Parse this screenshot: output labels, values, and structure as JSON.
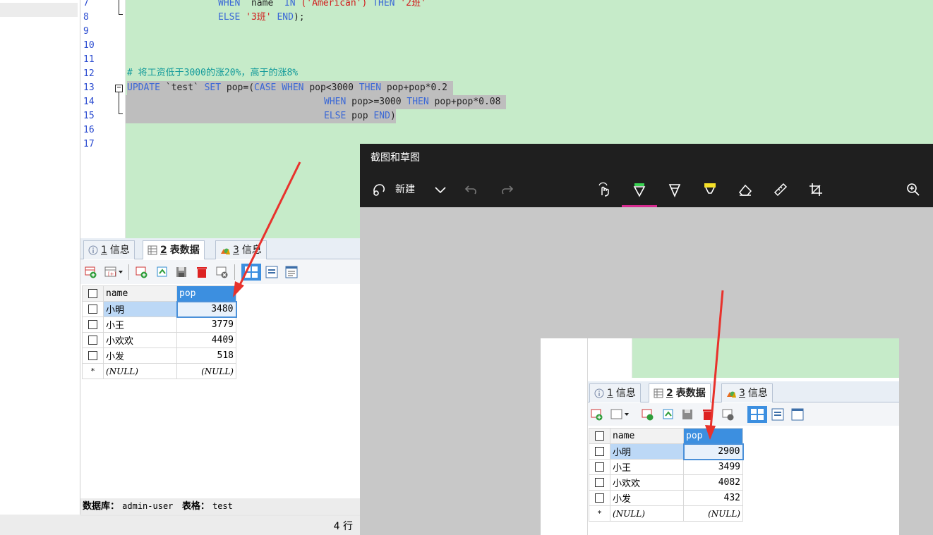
{
  "editor": {
    "line_numbers": [
      "7",
      "8",
      "9",
      "10",
      "11",
      "12",
      "13",
      "14",
      "15",
      "16",
      "17"
    ],
    "line7": {
      "kw1": "WHEN",
      "id": " `name` ",
      "kw2": "IN",
      "paren": " ('American') ",
      "kw3": "THEN",
      "str": " '2班'"
    },
    "line8": {
      "kw1": "ELSE",
      "str": " '3班'",
      "kw2": " END",
      "tail": ");"
    },
    "comment": "# 将工资低于3000的涨20%，高于的涨8%",
    "line13": {
      "kw1": "UPDATE",
      "p1": " `test` ",
      "kw2": "SET",
      "p2": " pop=(",
      "kw3": "CASE",
      "p3": " ",
      "kw4": "WHEN",
      "p4": " pop<3000 ",
      "kw5": "THEN",
      "p5": " pop+pop*0.2 "
    },
    "line14": {
      "kw1": "WHEN",
      "p1": " pop>=3000 ",
      "kw2": "THEN",
      "p2": " pop+pop*0.08 "
    },
    "line15": {
      "kw1": "ELSE",
      "p1": " pop ",
      "kw2": "END",
      "p2": ")"
    }
  },
  "result": {
    "tabs": [
      {
        "num": "1",
        "label": "信息"
      },
      {
        "num": "2",
        "label": "表数据"
      },
      {
        "num": "3",
        "label": "信息"
      }
    ],
    "columns": [
      "name",
      "pop"
    ],
    "rows": [
      {
        "name": "小明",
        "pop": "3480"
      },
      {
        "name": "小王",
        "pop": "3779"
      },
      {
        "name": "小欢欢",
        "pop": "4409"
      },
      {
        "name": "小发",
        "pop": "518"
      }
    ],
    "null_row": {
      "marker": "*",
      "name": "(NULL)",
      "pop": "(NULL)"
    }
  },
  "status": {
    "db_label": "数据库：",
    "db_value": "admin-user",
    "table_label": "表格：",
    "table_value": "test",
    "row_count": "4 行"
  },
  "snip": {
    "title": "截图和草图",
    "new_label": "新建"
  },
  "snip_image": {
    "tabs": [
      {
        "num": "1",
        "label": "信息"
      },
      {
        "num": "2",
        "label": "表数据"
      },
      {
        "num": "3",
        "label": "信息"
      }
    ],
    "columns": [
      "name",
      "pop"
    ],
    "rows": [
      {
        "name": "小明",
        "pop": "2900"
      },
      {
        "name": "小王",
        "pop": "3499"
      },
      {
        "name": "小欢欢",
        "pop": "4082"
      },
      {
        "name": "小发",
        "pop": "432"
      }
    ],
    "null_row": {
      "marker": "*",
      "name": "(NULL)",
      "pop": "(NULL)"
    }
  },
  "colors": {
    "editor_bg": "#c6ebc9",
    "keyword": "#3a68d6",
    "string": "#d11d1d",
    "comment": "#129a9a",
    "selection": "#bebebe",
    "header_selected": "#3c8fe0",
    "annotation_arrow": "#e8322c",
    "snip_bar": "#1f1f1f",
    "ink_accent": "#d62b8f"
  }
}
